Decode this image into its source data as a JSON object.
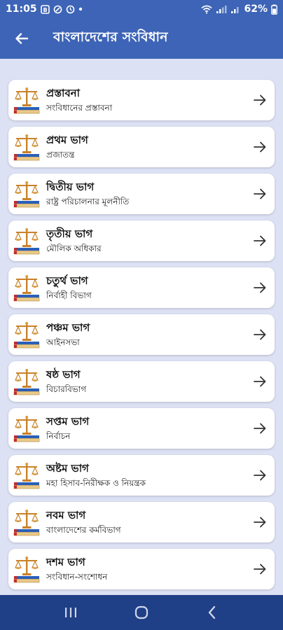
{
  "status": {
    "time": "11:05",
    "battery": "62%"
  },
  "header": {
    "title": "বাংলাদেশের সংবিধান"
  },
  "colors": {
    "app_bar": "#3d64b6",
    "background": "#dde1f4",
    "nav_bar": "#1f3f86",
    "card": "#ffffff",
    "icon_gold": "#d08a2c",
    "icon_red": "#c42a2a",
    "icon_blue": "#2a5fb8"
  },
  "items": [
    {
      "title": "প্রস্তাবনা",
      "subtitle": "সংবিধানের প্রস্তাবনা"
    },
    {
      "title": "প্রথম ভাগ",
      "subtitle": "প্রজাতন্ত্র"
    },
    {
      "title": "দ্বিতীয় ভাগ",
      "subtitle": "রাষ্ট্র পরিচালনার মূলনীতি"
    },
    {
      "title": "তৃতীয় ভাগ",
      "subtitle": "মৌলিক অধিকার"
    },
    {
      "title": "চতুর্থ ভাগ",
      "subtitle": "নির্বাহী বিভাগ"
    },
    {
      "title": "পঞ্চম ভাগ",
      "subtitle": "আইনসভা"
    },
    {
      "title": "ষষ্ঠ ভাগ",
      "subtitle": "বিচারবিভাগ"
    },
    {
      "title": "সপ্তম ভাগ",
      "subtitle": "নির্বাচন"
    },
    {
      "title": "অষ্টম ভাগ",
      "subtitle": "মহা হিসাব-নিরীক্ষক ও নিয়ন্ত্রক"
    },
    {
      "title": "নবম ভাগ",
      "subtitle": "বাংলাদেশের কর্মবিভাগ"
    },
    {
      "title": "দশম ভাগ",
      "subtitle": "সংবিধান-সংশোধন"
    }
  ],
  "icons": {
    "back": "arrow-left-icon",
    "item_icon": "law-scales-books-icon",
    "item_arrow": "arrow-right-icon",
    "nav_recents": "recents-icon",
    "nav_home": "home-icon",
    "nav_back": "back-chevron-icon"
  }
}
